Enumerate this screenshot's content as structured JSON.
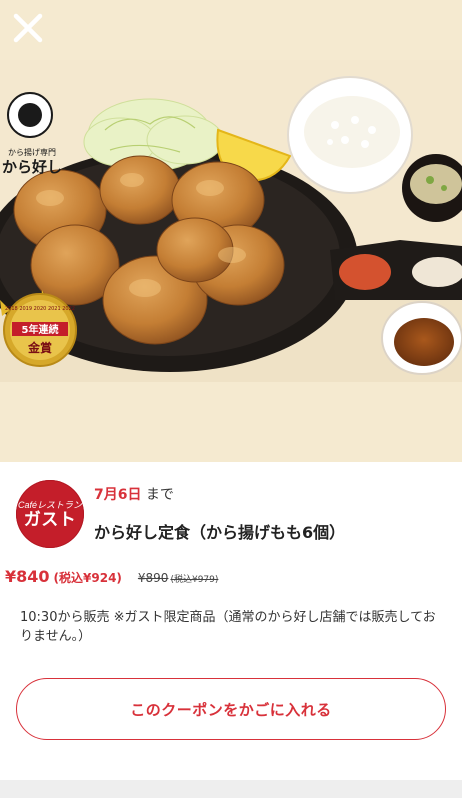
{
  "icons": {
    "close": "close-icon"
  },
  "hero": {
    "shop_logo_text": "から好し",
    "shop_logo_sub": "から揚げ専門",
    "badge_years": "2018 2019 2020 2021 2022",
    "badge_title": "5年連続",
    "badge_award": "金賞"
  },
  "brand": {
    "cafe": "Caféレストラン",
    "name": "ガスト"
  },
  "coupon": {
    "deadline_date": "7月6日",
    "deadline_suffix": " まで",
    "title": "から好し定食（から揚げもも6個）",
    "price": "¥840",
    "price_tax": "(税込¥924)",
    "original_price": "¥890",
    "original_price_tax": "(税込¥979)",
    "description": "10:30から販売 ※ガスト限定商品（通常のから好し店舗では販売しておりません。）",
    "add_button": "このクーポンをかごに入れる"
  },
  "colors": {
    "accent": "#d8313a",
    "hero_bg": "#f5ead0",
    "brand_red": "#c41e2a"
  }
}
